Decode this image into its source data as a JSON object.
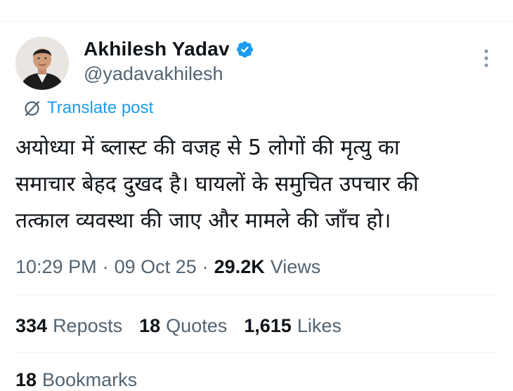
{
  "author": {
    "display_name": "Akhilesh Yadav",
    "handle": "@yadavakhilesh",
    "verified": true,
    "verified_color": "#1d9bf0",
    "avatar_icon": "profile-photo"
  },
  "actions": {
    "more_icon": "more-vertical-icon",
    "translate_label": "Translate post",
    "translate_icon": "globe-slash-icon"
  },
  "tweet": {
    "lines": [
      "अयोध्या में ब्लास्ट की वजह से 5 लोगों की मृत्यु का",
      "समाचार बेहद दुखद है। घायलों के समुचित उपचार की",
      "तत्काल व्यवस्था की जाए और मामले की जाँच हो।"
    ]
  },
  "meta": {
    "time": "10:29 PM",
    "separator": "·",
    "date": "09 Oct 25",
    "views_count": "29.2K",
    "views_label": "Views"
  },
  "stats": {
    "reposts_count": "334",
    "reposts_label": "Reposts",
    "quotes_count": "18",
    "quotes_label": "Quotes",
    "likes_count": "1,615",
    "likes_label": "Likes",
    "bookmarks_count": "18",
    "bookmarks_label": "Bookmarks"
  },
  "colors": {
    "text_primary": "#0f1419",
    "text_secondary": "#536471",
    "accent": "#1d9bf0",
    "divider": "#eff3f4"
  }
}
